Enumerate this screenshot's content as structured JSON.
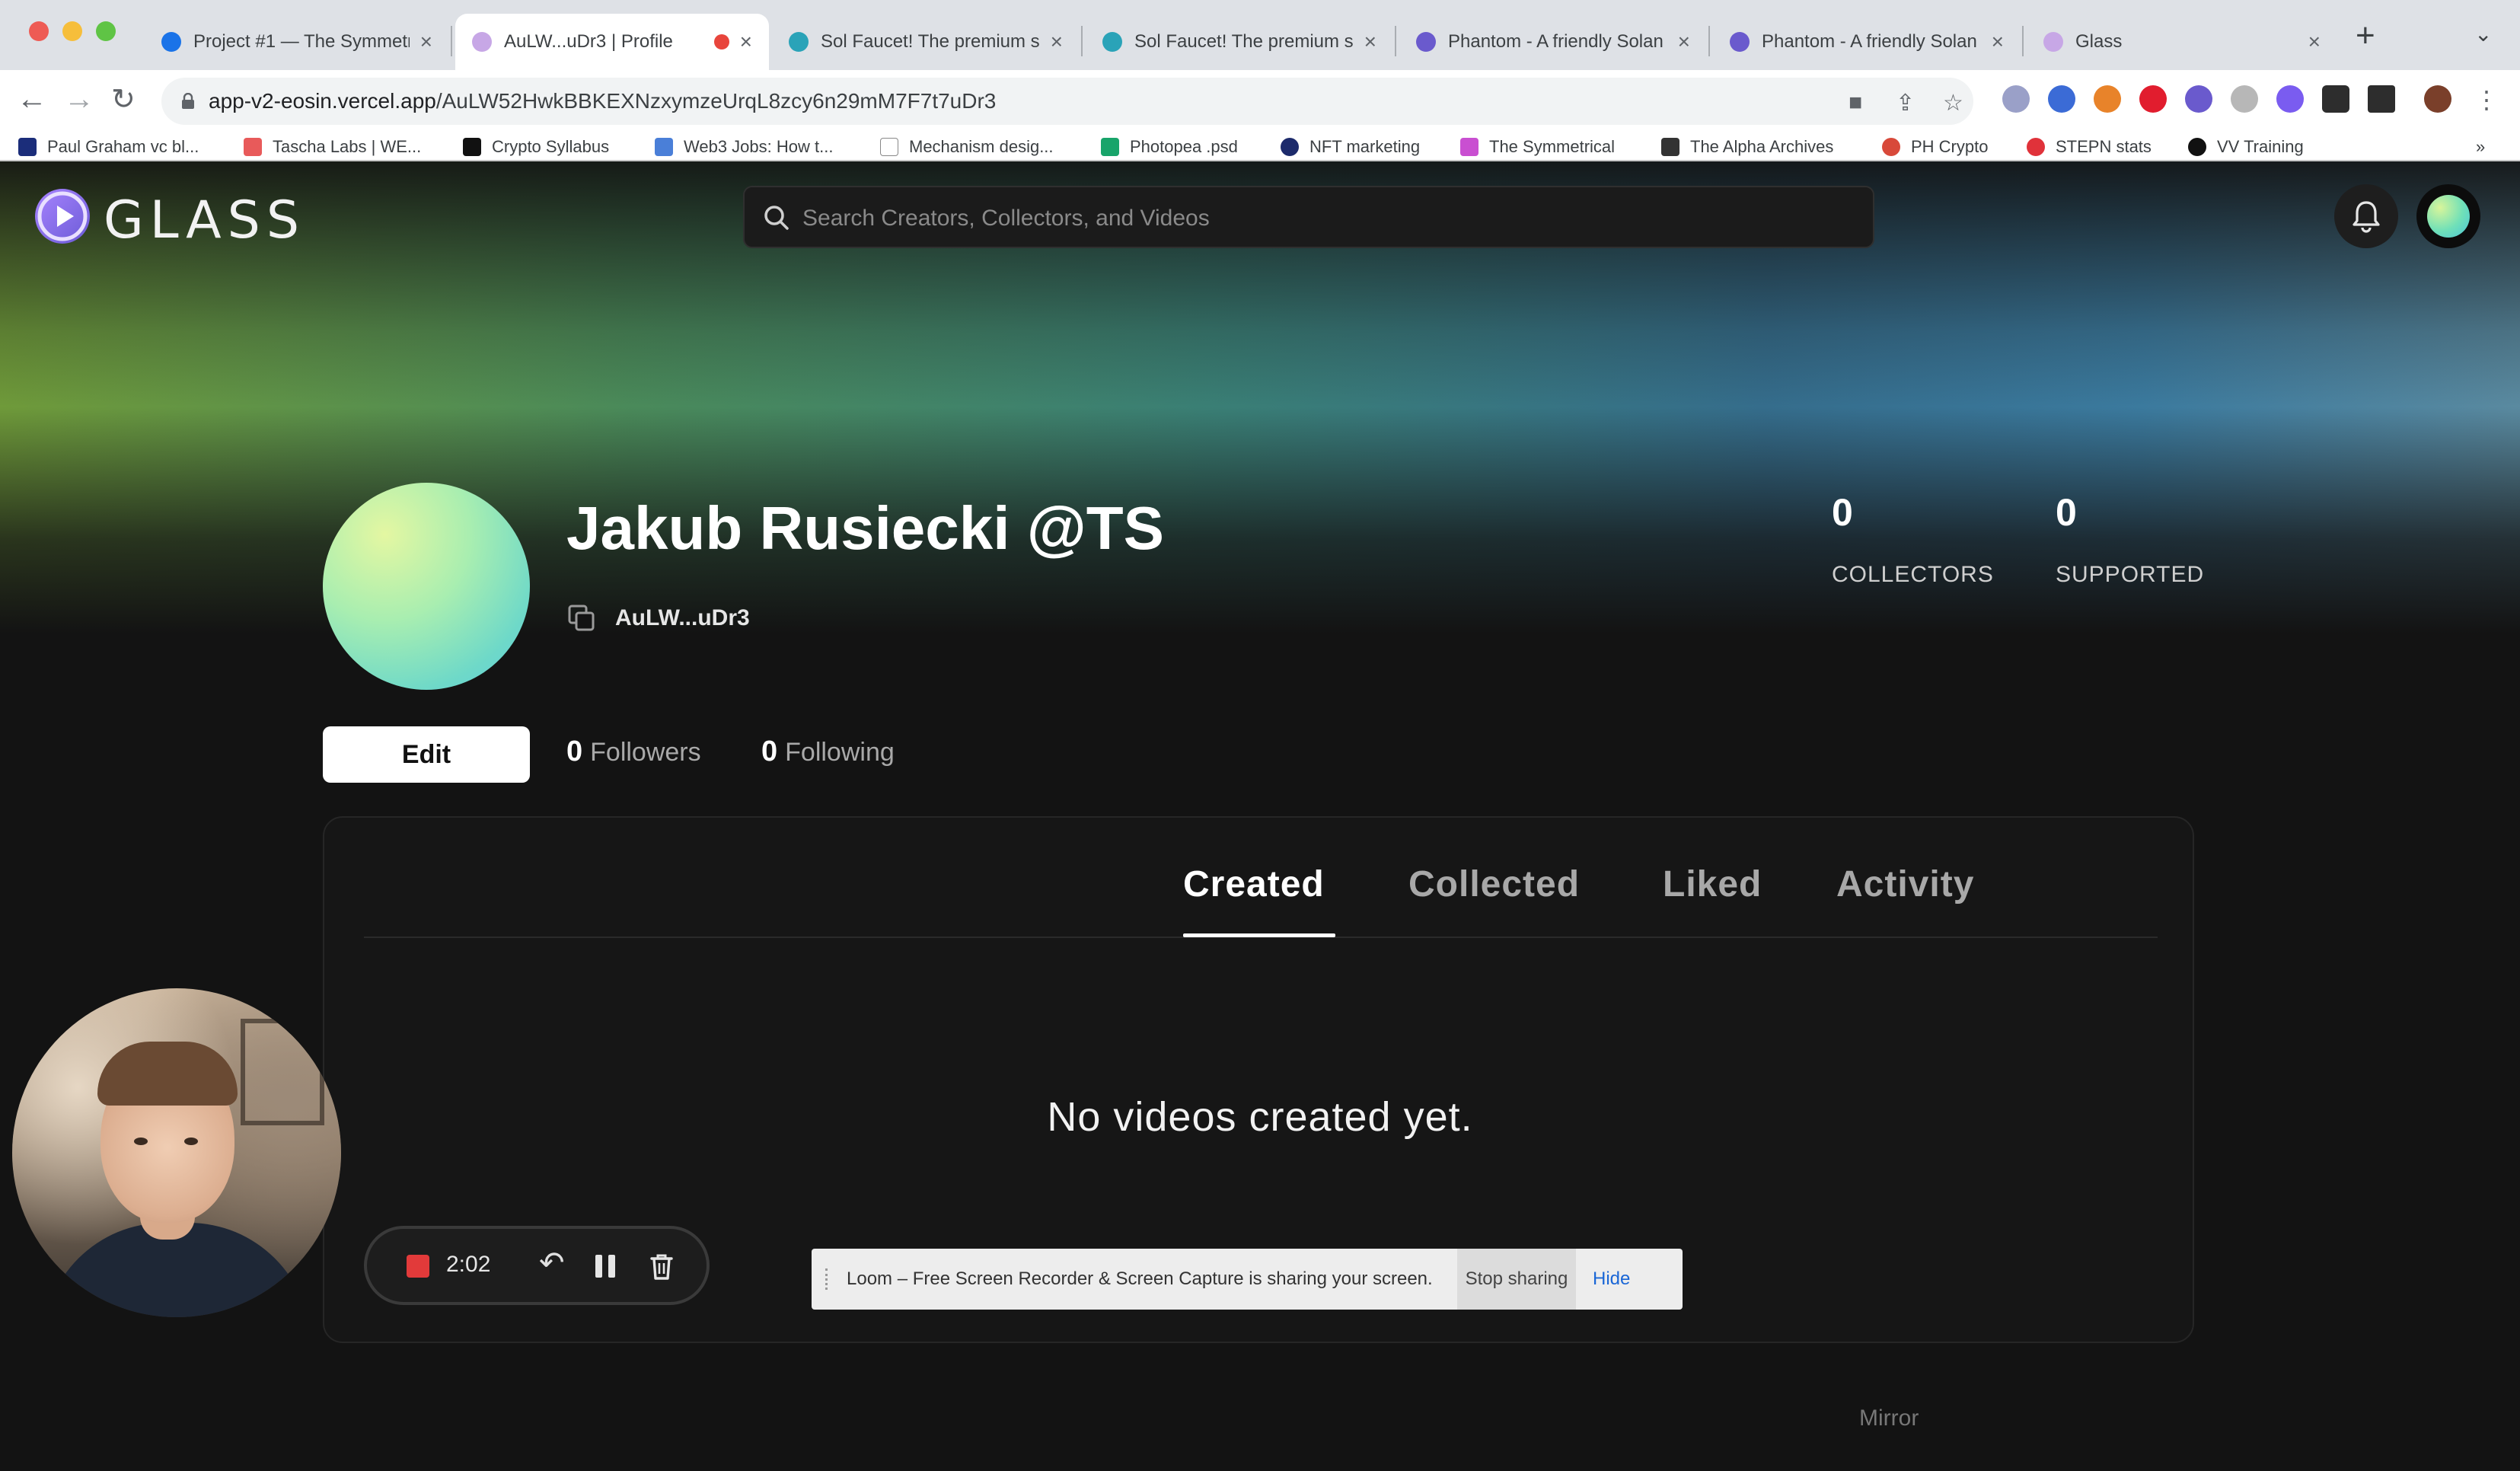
{
  "browser": {
    "tabs": [
      {
        "title": "Project #1 — The Symmetr",
        "favicon_color": "#1a73e8"
      },
      {
        "title": "AuLW...uDr3 | Profile",
        "favicon_color": "#c7a7e6",
        "active": true,
        "recording": true
      },
      {
        "title": "Sol Faucet! The premium s",
        "favicon_color": "#2aa3b8"
      },
      {
        "title": "Sol Faucet! The premium s",
        "favicon_color": "#2aa3b8"
      },
      {
        "title": "Phantom - A friendly Solan",
        "favicon_color": "#6a5acd"
      },
      {
        "title": "Phantom - A friendly Solan",
        "favicon_color": "#6a5acd"
      },
      {
        "title": "Glass",
        "favicon_color": "#c7a7e6"
      }
    ],
    "url_host": "app-v2-eosin.vercel.app",
    "url_path": "/AuLW52HwkBBKEXNzxymzeUrqL8zcy6n29mM7F7t7uDr3",
    "bookmarks": [
      {
        "label": "Paul Graham vc bl...",
        "color": "#1b2d7a"
      },
      {
        "label": "Tascha Labs | WE...",
        "color": "#e85a5a"
      },
      {
        "label": "Crypto Syllabus",
        "color": "#111111"
      },
      {
        "label": "Web3 Jobs: How t...",
        "color": "#4a7fd8"
      },
      {
        "label": "Mechanism desig...",
        "color": "#ffffff"
      },
      {
        "label": "Photopea .psd",
        "color": "#18a46a"
      },
      {
        "label": "NFT marketing",
        "color": "#1c2a6b"
      },
      {
        "label": "The Symmetrical",
        "color": "#c94fd1"
      },
      {
        "label": "The Alpha Archives",
        "color": "#333333"
      },
      {
        "label": "PH Crypto",
        "color": "#d8493a"
      },
      {
        "label": "STEPN stats",
        "color": "#e0323a"
      },
      {
        "label": "VV Training",
        "color": "#111111"
      }
    ]
  },
  "app": {
    "logo_text": "GLASS",
    "search_placeholder": "Search Creators, Collectors, and Videos"
  },
  "profile": {
    "name": "Jakub Rusiecki @TS",
    "address_short": "AuLW...uDr3",
    "collectors_count": "0",
    "collectors_label": "COLLECTORS",
    "supported_count": "0",
    "supported_label": "SUPPORTED",
    "edit_label": "Edit",
    "followers_count": "0",
    "followers_label": "Followers",
    "following_count": "0",
    "following_label": "Following"
  },
  "content_tabs": {
    "created": "Created",
    "collected": "Collected",
    "liked": "Liked",
    "activity": "Activity",
    "active": "created"
  },
  "empty_state": "No videos created yet.",
  "footer_link": "Mirror",
  "loom": {
    "timer": "2:02",
    "share_message": "Loom – Free Screen Recorder & Screen Capture is sharing your screen.",
    "stop_sharing": "Stop sharing",
    "hide": "Hide"
  }
}
